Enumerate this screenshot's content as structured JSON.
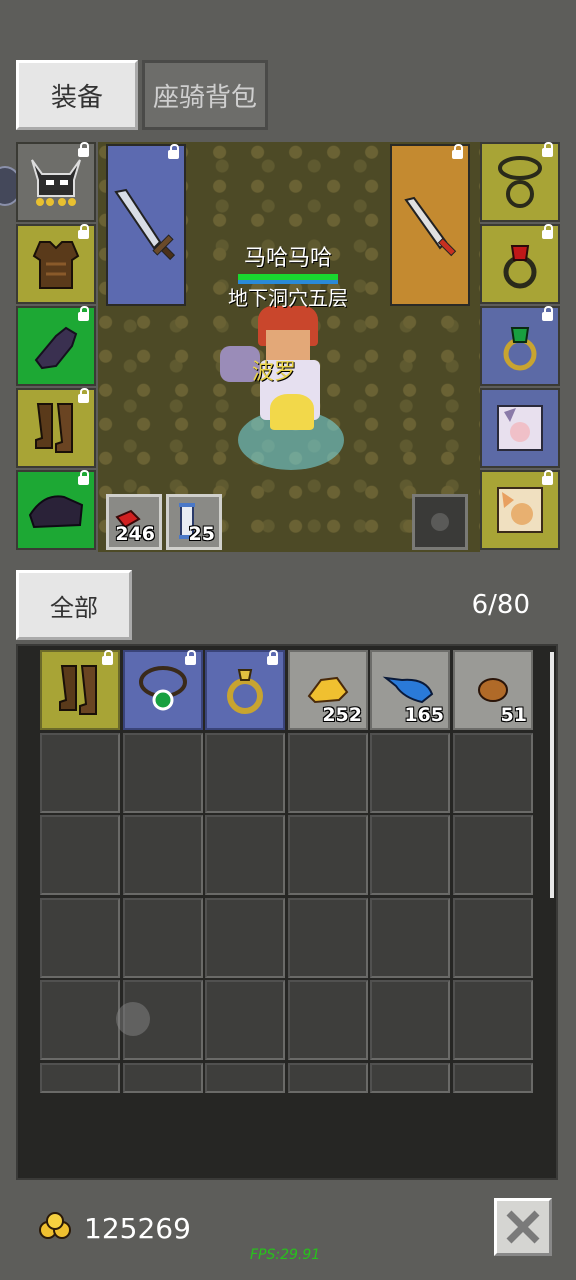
{
  "tabs": {
    "equipment": "装备",
    "mount_bag": "座骑背包"
  },
  "character": {
    "name": "马哈马哈",
    "location": "地下洞穴五层",
    "pet_name": "波罗"
  },
  "quick_items": [
    {
      "icon": "red-potion-icon",
      "count": "246"
    },
    {
      "icon": "scroll-icon",
      "count": "25"
    }
  ],
  "filter": {
    "label": "全部",
    "capacity": "6/80"
  },
  "inventory": [
    {
      "icon": "boots-icon",
      "count": ""
    },
    {
      "icon": "emerald-necklace-icon",
      "count": ""
    },
    {
      "icon": "gold-ring-icon",
      "count": ""
    },
    {
      "icon": "gold-ore-icon",
      "count": "252"
    },
    {
      "icon": "blue-feather-icon",
      "count": "165"
    },
    {
      "icon": "bread-icon",
      "count": "51"
    }
  ],
  "footer": {
    "gold": "125269",
    "fps": "FPS:29.91"
  },
  "colors": {
    "rarity_yellow": "#a8a436",
    "rarity_green": "#1da834",
    "rarity_blue": "#5c6aa6",
    "rarity_orange": "#c48a30"
  }
}
